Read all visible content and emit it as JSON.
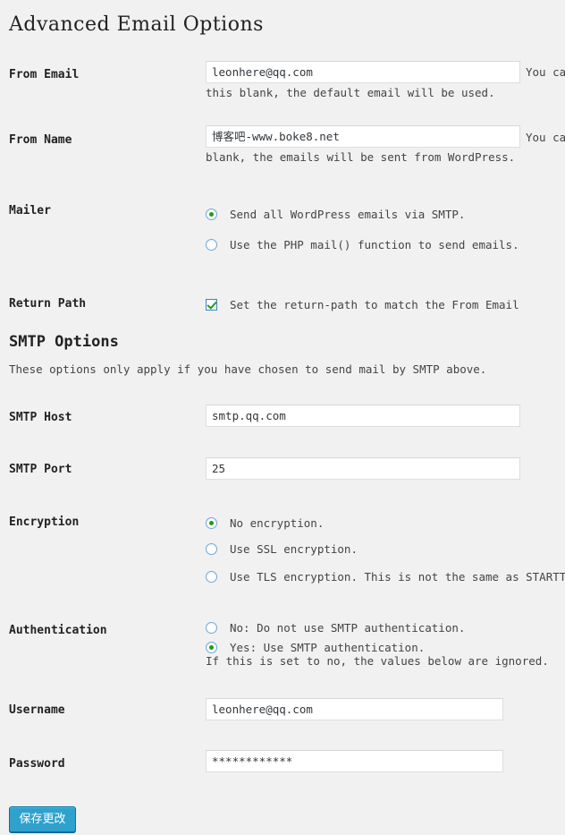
{
  "page": {
    "title": "Advanced Email Options",
    "background_color": "#f1f1f1"
  },
  "sections": {
    "smtp_options": {
      "heading": "SMTP Options",
      "intro": "These options only apply if you have chosen to send mail by SMTP above."
    }
  },
  "fields": {
    "from_email": {
      "label": "From Email",
      "value": "leonhere@qq.com",
      "side_hint": "You ca",
      "hint": "this blank, the default email will be used."
    },
    "from_name": {
      "label": "From Name",
      "value": "博客吧-www.boke8.net",
      "side_hint": "You ca",
      "hint": "blank, the emails will be sent from WordPress."
    },
    "smtp_host": {
      "label": "SMTP Host",
      "value": "smtp.qq.com"
    },
    "smtp_port": {
      "label": "SMTP Port",
      "value": "25"
    },
    "username": {
      "label": "Username",
      "value": "leonhere@qq.com"
    },
    "password": {
      "label": "Password",
      "value": "************"
    }
  },
  "mailer": {
    "label": "Mailer",
    "options": [
      {
        "label": "Send all WordPress emails via SMTP.",
        "selected": true
      },
      {
        "label": "Use the PHP mail() function to send emails.",
        "selected": false
      }
    ]
  },
  "return_path": {
    "label": "Return Path",
    "checkbox_label": "Set the return-path to match the From Email",
    "checked": true
  },
  "encryption": {
    "label": "Encryption",
    "options": [
      {
        "label": "No encryption.",
        "selected": true
      },
      {
        "label": "Use SSL encryption.",
        "selected": false
      },
      {
        "label": "Use TLS encryption. This is not the same as STARTTLS.",
        "selected": false
      }
    ]
  },
  "authentication": {
    "label": "Authentication",
    "options": [
      {
        "label": "No: Do not use SMTP authentication.",
        "selected": false
      },
      {
        "label": "Yes: Use SMTP authentication.",
        "selected": true
      }
    ],
    "note": "If this is set to no, the values below are ignored."
  },
  "submit": {
    "label": "保存更改",
    "color": "#2ea2cc"
  }
}
